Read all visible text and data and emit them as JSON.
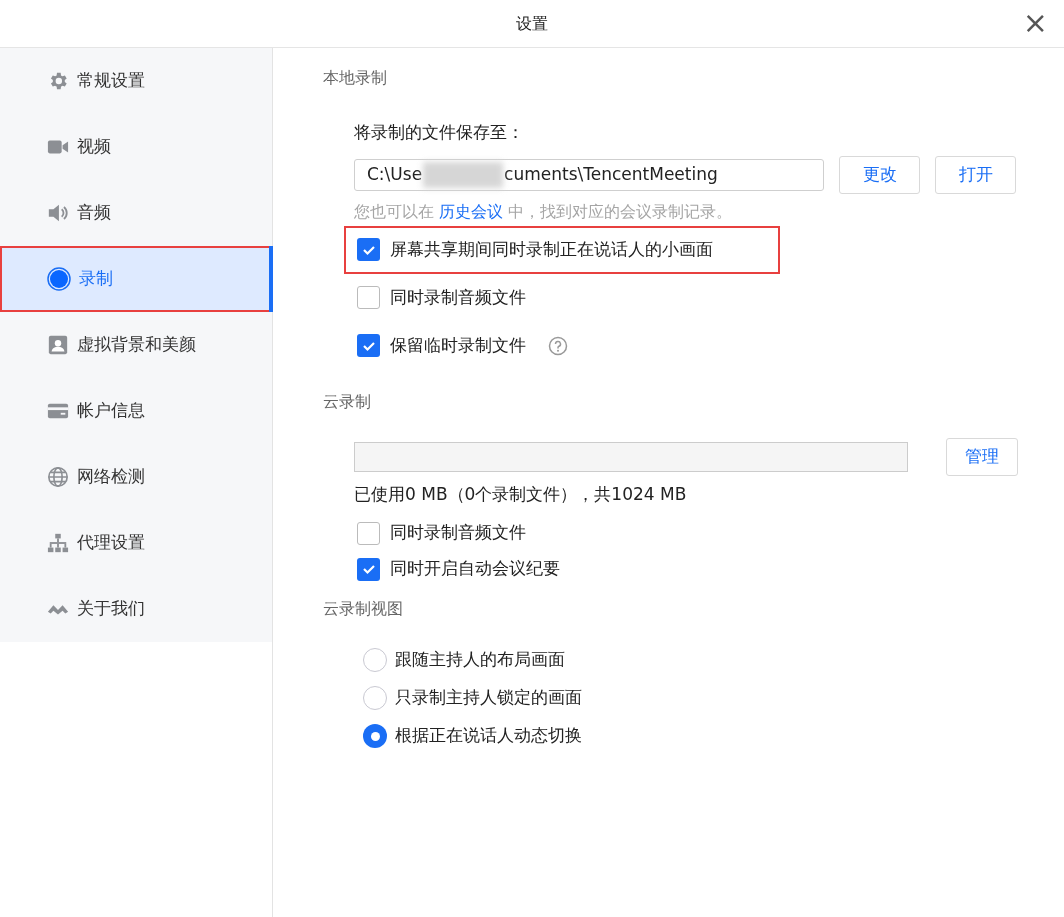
{
  "window": {
    "title": "设置",
    "close": "×"
  },
  "sidebar": {
    "items": [
      {
        "label": "常规设置",
        "selected": false,
        "highlighted": false
      },
      {
        "label": "视频",
        "selected": false,
        "highlighted": false
      },
      {
        "label": "音频",
        "selected": false,
        "highlighted": false
      },
      {
        "label": "录制",
        "selected": true,
        "highlighted": true
      },
      {
        "label": "虚拟背景和美颜",
        "selected": false,
        "highlighted": false
      },
      {
        "label": "帐户信息",
        "selected": false,
        "highlighted": false
      },
      {
        "label": "网络检测",
        "selected": false,
        "highlighted": false
      },
      {
        "label": "代理设置",
        "selected": false,
        "highlighted": false
      },
      {
        "label": "关于我们",
        "selected": false,
        "highlighted": false
      }
    ]
  },
  "local_recording": {
    "heading": "本地录制",
    "save_label": "将录制的文件保存至：",
    "path": {
      "start": "C:\\Use",
      "end": "cuments\\TencentMeeting",
      "redacted": true
    },
    "buttons": [
      "更改",
      "打开"
    ],
    "hint_before": "您也可以在",
    "hint_link": "历史会议",
    "hint_after": "中，找到对应的会议录制记录。",
    "options": [
      {
        "label": "屏幕共享期间同时录制正在说话人的小画面",
        "checked": true,
        "highlighted": true,
        "help": false
      },
      {
        "label": "同时录制音频文件",
        "checked": false,
        "highlighted": false,
        "help": false
      },
      {
        "label": "保留临时录制文件",
        "checked": true,
        "highlighted": false,
        "help": true
      }
    ]
  },
  "cloud_recording": {
    "heading": "云录制",
    "button": "管理",
    "usage": "已使用0 MB（0个录制文件），共1024 MB",
    "options": [
      {
        "label": "同时录制音频文件",
        "checked": false
      },
      {
        "label": "同时开启自动会议纪要",
        "checked": true
      }
    ]
  },
  "cloud_view": {
    "heading": "云录制视图",
    "options": [
      {
        "label": "跟随主持人的布局画面",
        "selected": false
      },
      {
        "label": "只录制主持人锁定的画面",
        "selected": false
      },
      {
        "label": "根据正在说话人动态切换",
        "selected": true
      }
    ]
  }
}
